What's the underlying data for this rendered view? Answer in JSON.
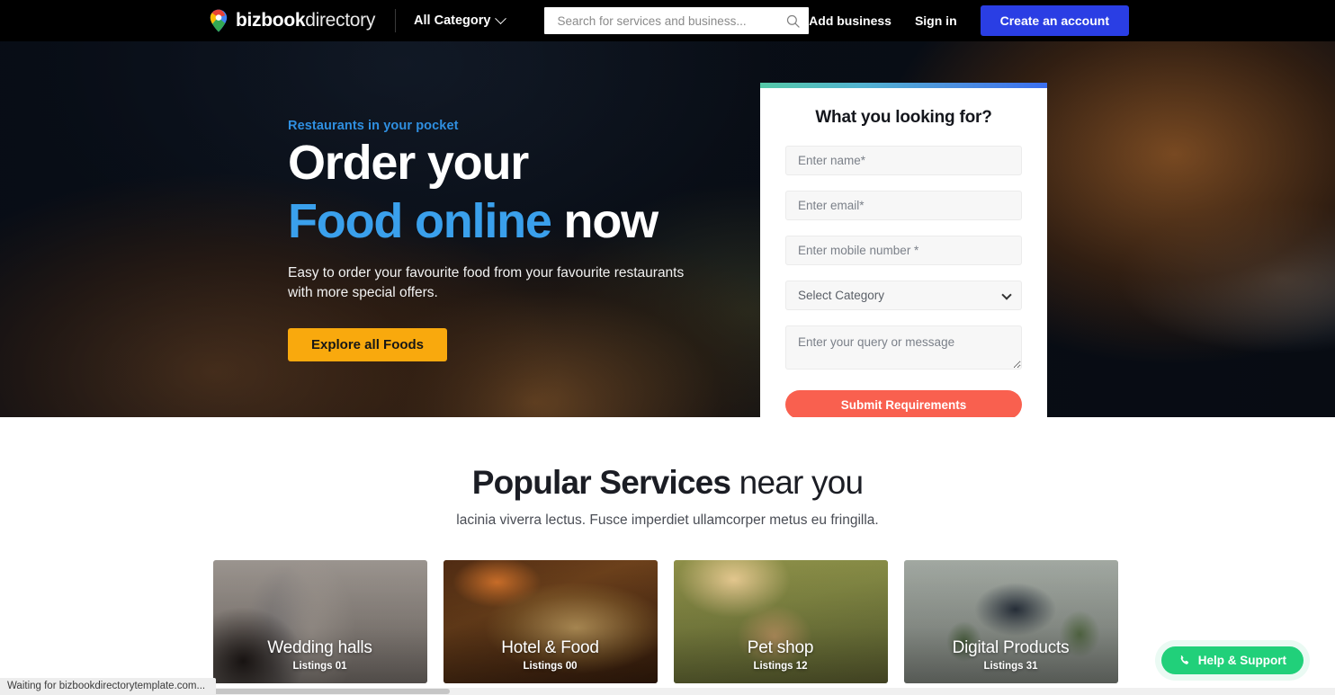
{
  "header": {
    "brand": {
      "bold": "bizbook",
      "light": "directory",
      "logo_icon": "map-pin-icon"
    },
    "category_select": {
      "label": "All Category",
      "icon": "chevron-down-icon"
    },
    "search": {
      "placeholder": "Search for services and business...",
      "value": "",
      "icon": "search-icon"
    },
    "add_business": "Add business",
    "sign_in": "Sign in",
    "create_account": "Create an account",
    "accent_blue": "#2a3ee4",
    "background": "#000000"
  },
  "hero": {
    "kicker": "Restaurants in your pocket",
    "title_line1": "Order your",
    "title_accent": "Food online",
    "title_tail": " now",
    "subtitle": "Easy to order your favourite food from your favourite restaurants with more special offers.",
    "cta": "Explore all Foods",
    "cta_color": "#f9a90d",
    "accent_color": "#3aa0ec"
  },
  "lead_form": {
    "title": "What you looking for?",
    "name_placeholder": "Enter name*",
    "email_placeholder": "Enter email*",
    "mobile_placeholder": "Enter mobile number *",
    "category_selected": "Select Category",
    "category_options": [
      "Select Category"
    ],
    "message_placeholder": "Enter your query or message",
    "submit_label": "Submit Requirements",
    "submit_color": "#f9604f",
    "gradient_from": "#55c9a7",
    "gradient_to": "#3b6ff0"
  },
  "services": {
    "title_bold": "Popular Services",
    "title_rest": " near you",
    "description": "lacinia viverra lectus. Fusce imperdiet ullamcorper metus eu fringilla.",
    "cards": [
      {
        "name": "Wedding halls",
        "listings": "Listings 01"
      },
      {
        "name": "Hotel & Food",
        "listings": "Listings 00"
      },
      {
        "name": "Pet shop",
        "listings": "Listings 12"
      },
      {
        "name": "Digital Products",
        "listings": "Listings 31"
      }
    ]
  },
  "help_widget": {
    "label": "Help & Support",
    "icon": "phone-icon",
    "color": "#21d07a"
  },
  "status_bar": {
    "text": "Waiting for bizbookdirectorytemplate.com..."
  }
}
